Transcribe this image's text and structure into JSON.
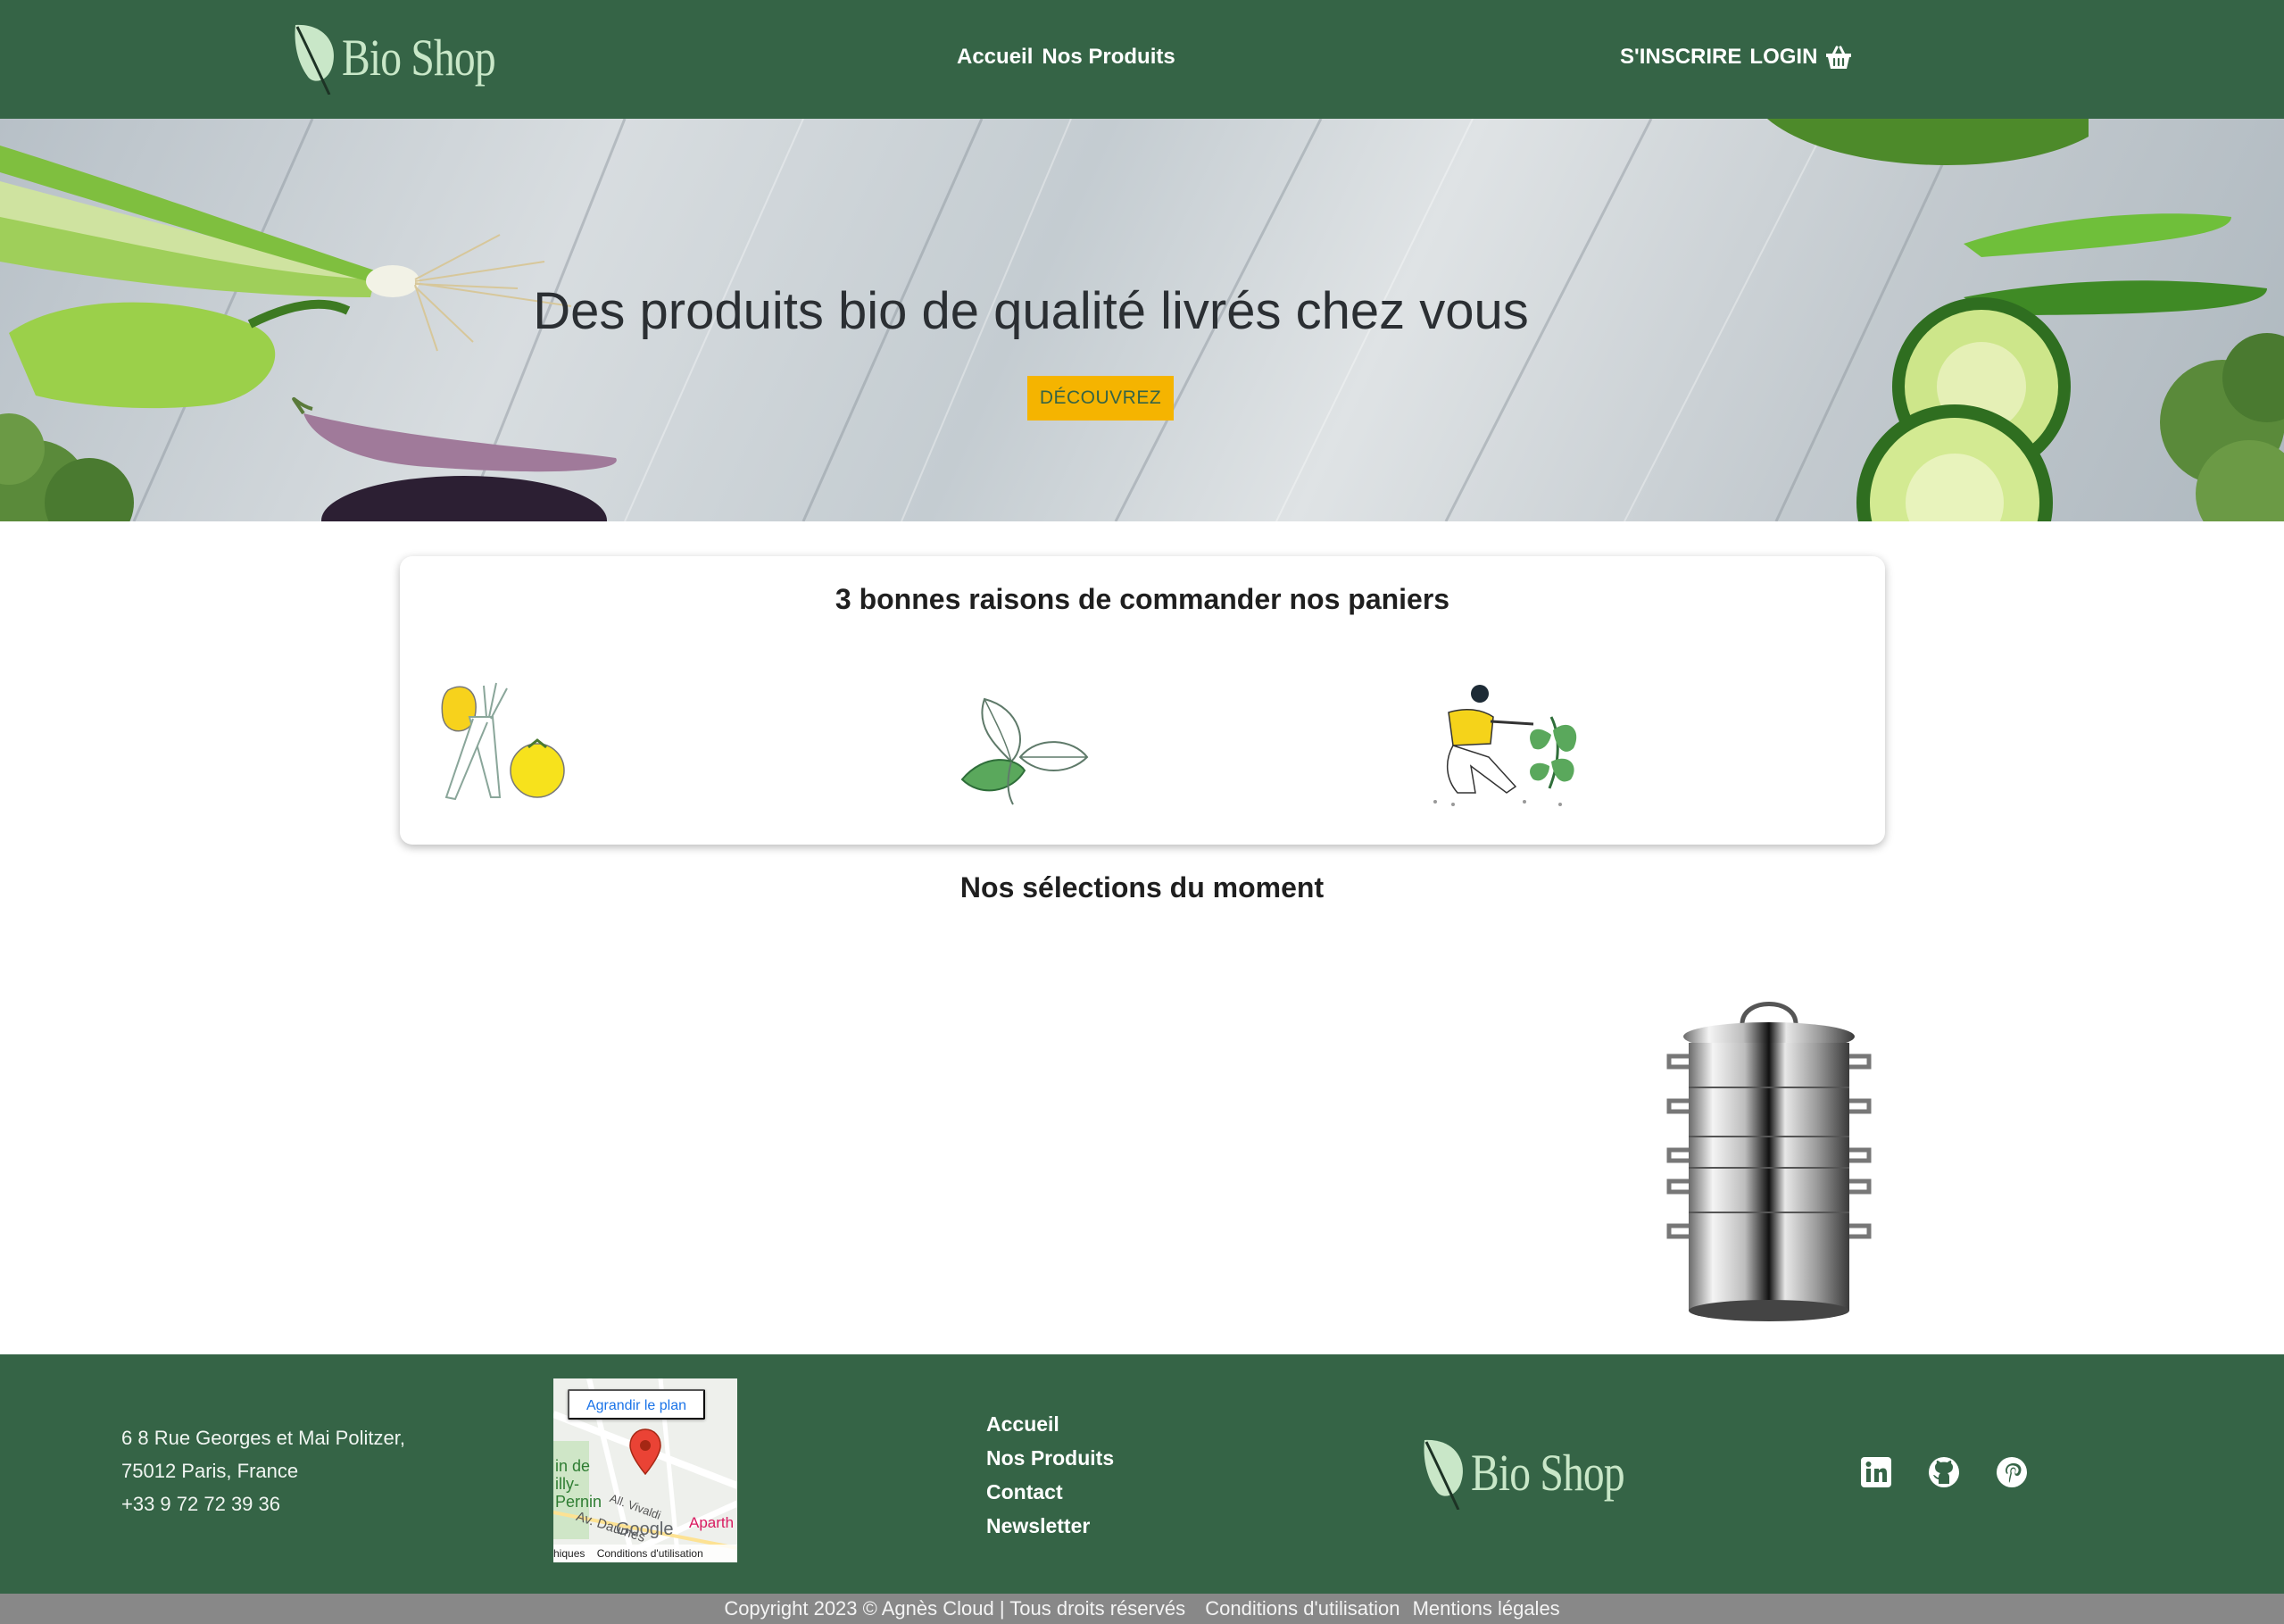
{
  "header": {
    "logo_text": "Bio Shop",
    "nav": [
      {
        "label": "Accueil"
      },
      {
        "label": "Nos Produits"
      }
    ],
    "signup_label": "S'INSCRIRE",
    "login_label": "LOGIN",
    "basket_icon": "shopping-basket-icon"
  },
  "hero": {
    "title": "Des produits bio de qualité livrés chez vous",
    "button_label": "DÉCOUVREZ"
  },
  "reasons": {
    "title": "3 bonnes raisons de commander nos paniers",
    "illustrations": [
      "vegetables-illustration",
      "leaves-illustration",
      "gardener-illustration"
    ]
  },
  "selections": {
    "title": "Nos sélections du moment",
    "products": [
      {
        "image": "steamer-pot-image"
      }
    ]
  },
  "footer": {
    "address": {
      "line1": "6 8 Rue Georges et Mai Politzer,",
      "line2": "75012 Paris, France",
      "phone": "+33 9 72 72 39 36"
    },
    "map": {
      "enlarge_label": "Agrandir le plan",
      "terms_left": "hiques",
      "terms_right": "Conditions d'utilisation",
      "brand": "Google",
      "street_1": "All. Vivaldi",
      "street_2": "Av. Daumes",
      "place_1": "in de",
      "place_2": "illy-",
      "place_3": "Pernin",
      "place_4": "Aparth"
    },
    "links": [
      {
        "label": "Accueil"
      },
      {
        "label": "Nos Produits"
      },
      {
        "label": "Contact"
      },
      {
        "label": "Newsletter"
      }
    ],
    "logo_text": "Bio Shop",
    "social": [
      "linkedin-icon",
      "github-icon",
      "pinterest-icon"
    ]
  },
  "copyright": {
    "text": "Copyright 2023 © Agnès Cloud | Tous droits réservés",
    "terms": "Conditions d'utilisation",
    "legal": "Mentions légales"
  },
  "colors": {
    "brand_green": "#356446",
    "logo_green": "#c9e7c8",
    "accent_yellow": "#f5b400",
    "copyright_grey": "#888888"
  }
}
